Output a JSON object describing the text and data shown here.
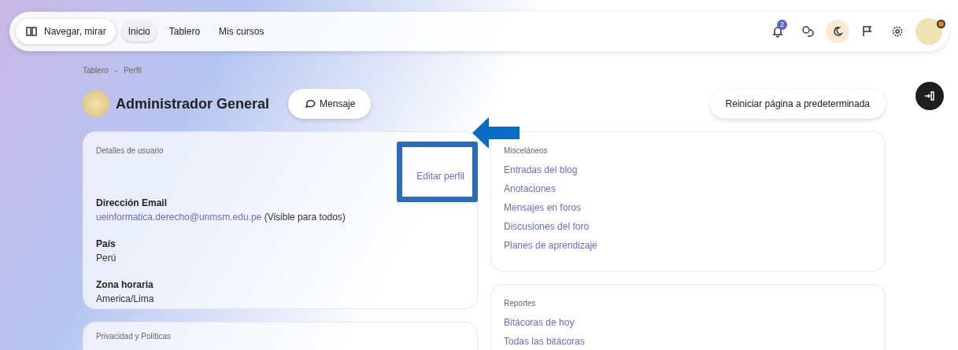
{
  "navbar": {
    "browse_button": "Navegar, mirar",
    "nav_items": [
      {
        "label": "Inicio",
        "selected": true
      },
      {
        "label": "Tablero",
        "selected": false
      },
      {
        "label": "Mis cursos",
        "selected": false
      }
    ],
    "notification_count": "2"
  },
  "breadcrumb": {
    "items": [
      "Tablero",
      "Perfil"
    ],
    "separator": "-"
  },
  "profile": {
    "name": "Administrador General",
    "message_button": "Mensaje",
    "reset_button": "Reiniciar página a predeterminada"
  },
  "user_details": {
    "title": "Detalles de usuario",
    "edit_link": "Editar perfil",
    "fields": [
      {
        "label": "Dirección Email",
        "value": "ueinformatica.derecho@unmsm.edu.pe",
        "note": "(Visible para todos)",
        "kind": "link"
      },
      {
        "label": "País",
        "value": "Perú",
        "kind": "text"
      },
      {
        "label": "Zona horaria",
        "value": "America/Lima",
        "kind": "text"
      }
    ]
  },
  "privacy": {
    "title": "Privacidad y Políticas"
  },
  "misc": {
    "title": "Misceláneos",
    "links": [
      "Entradas del blog",
      "Anotaciones",
      "Mensajes en foros",
      "Discusiones del foro",
      "Planes de aprendizaje"
    ]
  },
  "reports": {
    "title": "Reportes",
    "links": [
      "Bitácoras de hoy",
      "Todas las bitácoras"
    ]
  }
}
